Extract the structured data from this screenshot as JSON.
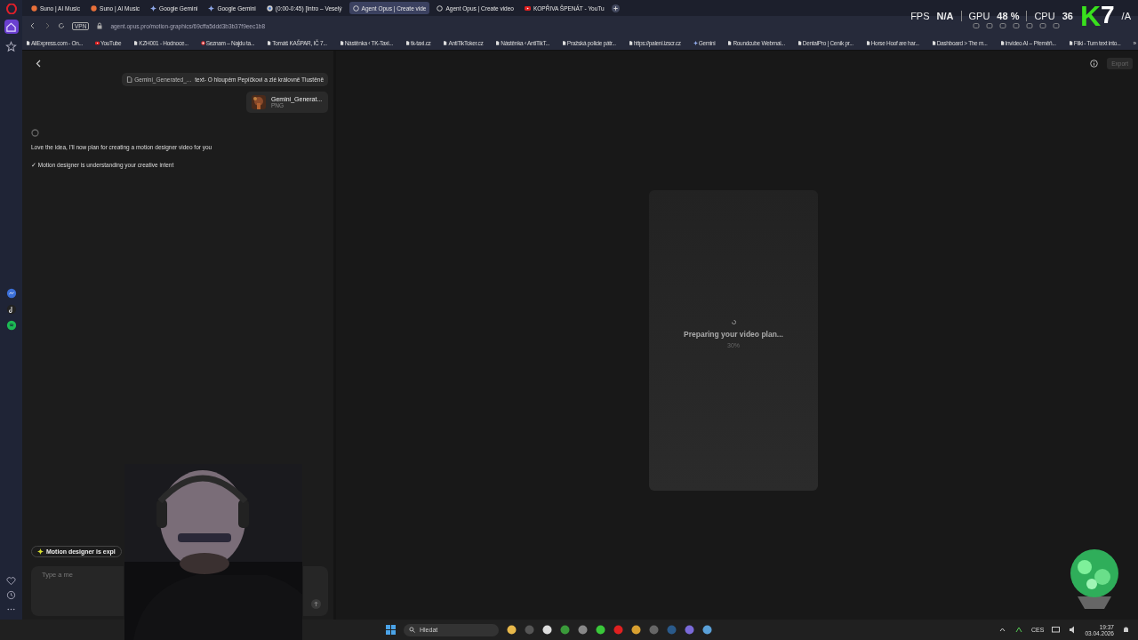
{
  "tabs": [
    {
      "title": "Suno | AI Music",
      "kind": "suno",
      "selected": false
    },
    {
      "title": "Suno | AI Music",
      "kind": "suno",
      "selected": false
    },
    {
      "title": "Google Gemini",
      "kind": "gemini",
      "selected": false
    },
    {
      "title": "Google Gemini",
      "kind": "gemini",
      "selected": false
    },
    {
      "title": "(0:00-0:45) [Intro – Veselý",
      "kind": "chrome",
      "selected": false
    },
    {
      "title": "Agent Opus | Create vide",
      "kind": "opus",
      "selected": true
    },
    {
      "title": "Agent Opus | Create video",
      "kind": "opus",
      "selected": false
    },
    {
      "title": "KOPŘIVA ŠPENÁT - YouTu",
      "kind": "youtube",
      "selected": false
    }
  ],
  "address_bar": {
    "badge": "VPN",
    "url": "agent.opus.pro/motion-graphics/69cffa5ddd3b3b37f9eec1b8"
  },
  "stats_overlay": [
    {
      "label": "FPS",
      "value": "N/A"
    },
    {
      "label": "GPU",
      "value": "48 %"
    },
    {
      "label": "CPU",
      "value": "36"
    }
  ],
  "stream_logo": {
    "letter": "K",
    "digit": "7",
    "trailing": "/A"
  },
  "bookmarks": [
    {
      "title": "AliExpress.com - On...",
      "kind": "page"
    },
    {
      "title": "YouTube",
      "kind": "youtube"
    },
    {
      "title": "KZH001 - Hodnoce...",
      "kind": "page"
    },
    {
      "title": "Seznam – Najdu ta...",
      "kind": "seznam"
    },
    {
      "title": "Tomáš KAŠPAR, IČ 7...",
      "kind": "page"
    },
    {
      "title": "Nástěnka ‹ TK-Taxi...",
      "kind": "page"
    },
    {
      "title": "tk-taxi.cz",
      "kind": "page"
    },
    {
      "title": "AntiTikToker.cz",
      "kind": "page"
    },
    {
      "title": "Nástěnka ‹ AntiTikT...",
      "kind": "page"
    },
    {
      "title": "Pražská policie pátr...",
      "kind": "page"
    },
    {
      "title": "https://paleni.izscr.cz",
      "kind": "page"
    },
    {
      "title": "Gemini",
      "kind": "gemini"
    },
    {
      "title": "Roundcube Webmai...",
      "kind": "page"
    },
    {
      "title": "DentalPro | Ceník pr...",
      "kind": "page"
    },
    {
      "title": "Horse Hoof are har...",
      "kind": "page"
    },
    {
      "title": "Dashboard > The m...",
      "kind": "page"
    },
    {
      "title": "Invideo AI – Přeměň...",
      "kind": "page"
    },
    {
      "title": "Fliki - Turn text into...",
      "kind": "page"
    }
  ],
  "bookmarks_more": "»",
  "sidebar": {
    "items": [
      {
        "kind": "home",
        "selected": true
      },
      {
        "kind": "star",
        "selected": false
      }
    ],
    "apps": [
      {
        "kind": "messenger",
        "color": "#3b6fd8"
      },
      {
        "kind": "tiktok",
        "color": "#222222"
      },
      {
        "kind": "spotify",
        "color": "#1db954"
      }
    ]
  },
  "chat": {
    "file_bubble": {
      "file": "Gemini_Generated_...",
      "text": "text- O hloupém Pepíčkovi a zlé královně Tlustěně"
    },
    "attachment": {
      "name": "Gemini_Generat...",
      "type": "PNG"
    },
    "messages": [
      "Love the idea, I'll now plan for creating a motion designer video for you",
      "✓ Motion designer is understanding your creative intent"
    ],
    "status_chip": "Motion designer is expl",
    "input": {
      "placeholder": "Type a me"
    }
  },
  "preview": {
    "export_button": {
      "label": "Export",
      "disabled": true
    },
    "status": "Preparing your video plan...",
    "percent": "30%"
  },
  "taskbar": {
    "search": "Hledat",
    "language": "CES",
    "time": "19:37",
    "date": "03.04.2026"
  }
}
